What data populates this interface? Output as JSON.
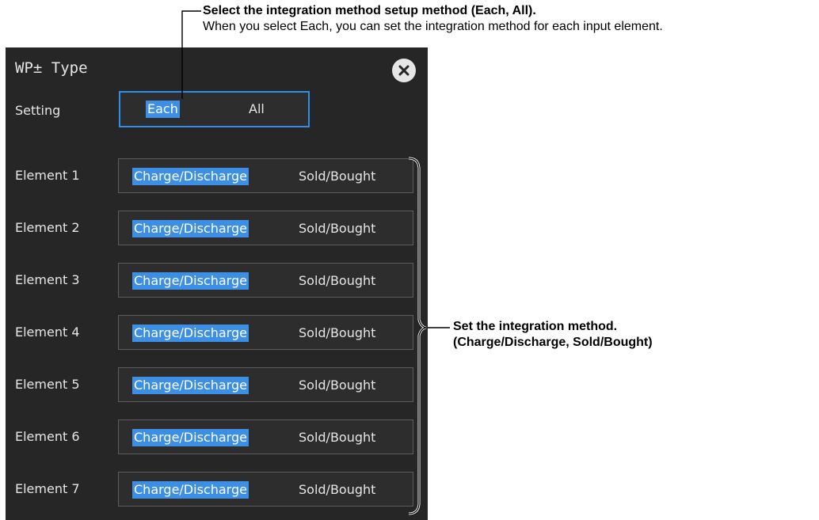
{
  "callouts": {
    "top_title": "Select the integration method setup method (Each, All).",
    "top_desc": "When you select Each, you can set the integration method for each input element.",
    "right_line1": "Set the integration method.",
    "right_line2": "(Charge/Discharge, Sold/Bought)"
  },
  "dialog": {
    "title": "WP± Type",
    "close_icon": "close-icon",
    "setting_label": "Setting",
    "setting_options": [
      "Each",
      "All"
    ],
    "setting_selected": "Each",
    "method_options": [
      "Charge/Discharge",
      "Sold/Bought"
    ],
    "elements": [
      {
        "label": "Element 1",
        "selected": "Charge/Discharge"
      },
      {
        "label": "Element 2",
        "selected": "Charge/Discharge"
      },
      {
        "label": "Element 3",
        "selected": "Charge/Discharge"
      },
      {
        "label": "Element 4",
        "selected": "Charge/Discharge"
      },
      {
        "label": "Element 5",
        "selected": "Charge/Discharge"
      },
      {
        "label": "Element 6",
        "selected": "Charge/Discharge"
      },
      {
        "label": "Element 7",
        "selected": "Charge/Discharge"
      }
    ]
  },
  "colors": {
    "panel_bg": "#262626",
    "selection": "#3d8fe6",
    "focus_border": "#2f8fe8",
    "text": "#e6e6e6"
  }
}
